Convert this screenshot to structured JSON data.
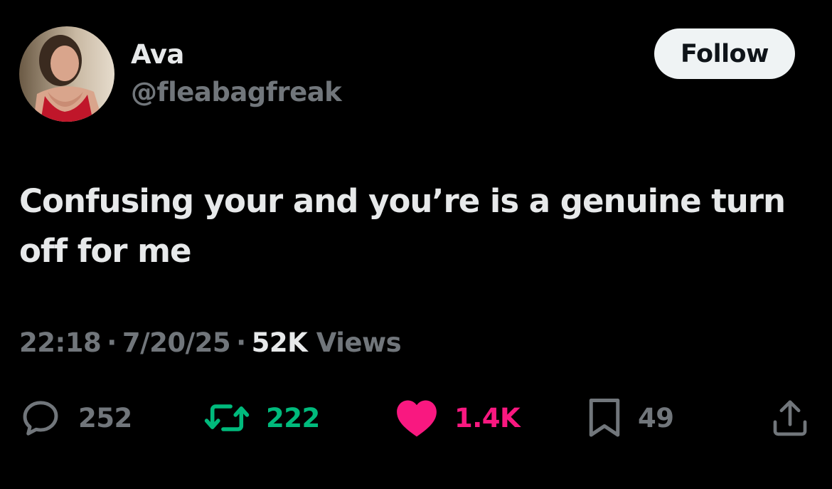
{
  "author": {
    "display_name": "Ava",
    "handle": "@fleabagfreak",
    "avatar_icon": "profile-photo"
  },
  "follow_label": "Follow",
  "tweet": {
    "text": "Confusing your and you’re is a genuine turn off for me"
  },
  "meta": {
    "time": "22:18",
    "date": "7/20/25",
    "separator": "·",
    "views_count": "52K",
    "views_label": "Views"
  },
  "actions": {
    "replies": "252",
    "retweets": "222",
    "likes": "1.4K",
    "bookmarks": "49"
  },
  "colors": {
    "background": "#000000",
    "primary_text": "#e7e9ea",
    "secondary_text": "#71767b",
    "retweet": "#00ba7c",
    "like": "#f91880",
    "follow_bg": "#eff3f4"
  }
}
